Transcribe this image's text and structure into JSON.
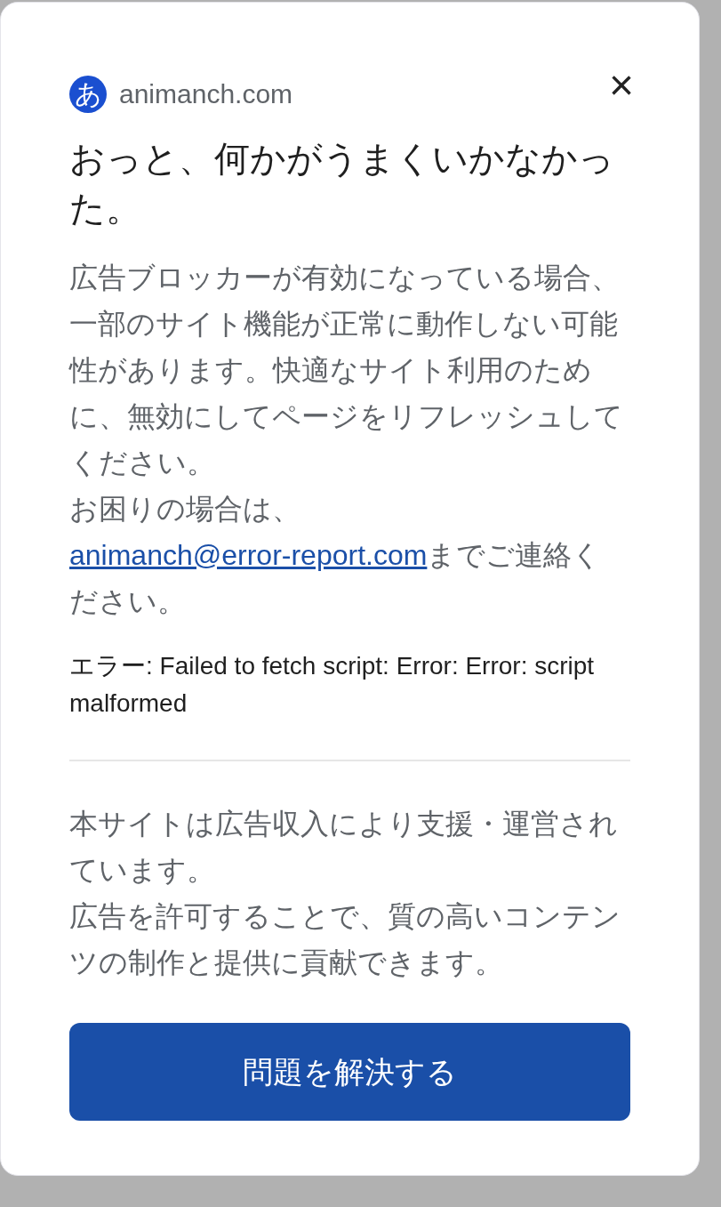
{
  "dialog": {
    "site": "animanch.com",
    "logo_glyph": "あ",
    "close": "×",
    "title": "おっと、何かがうまくいかなかった。",
    "message": "広告ブロッカーが有効になっている場合、一部のサイト機能が正常に動作しない可能性があります。快適なサイト利用のために、無効にしてページをリフレッシュしてください。",
    "help": {
      "before": "お困りの場合は、",
      "link": "animanch@error-report.com",
      "after": "までご連絡ください。"
    },
    "error": "エラー: Failed to fetch script: Error: Error: script malformed",
    "footer": [
      "本サイトは広告収入により支援・運営されています。",
      "広告を許可することで、質の高いコンテンツの制作と提供に貢献できます。"
    ],
    "button": "問題を解決する"
  }
}
